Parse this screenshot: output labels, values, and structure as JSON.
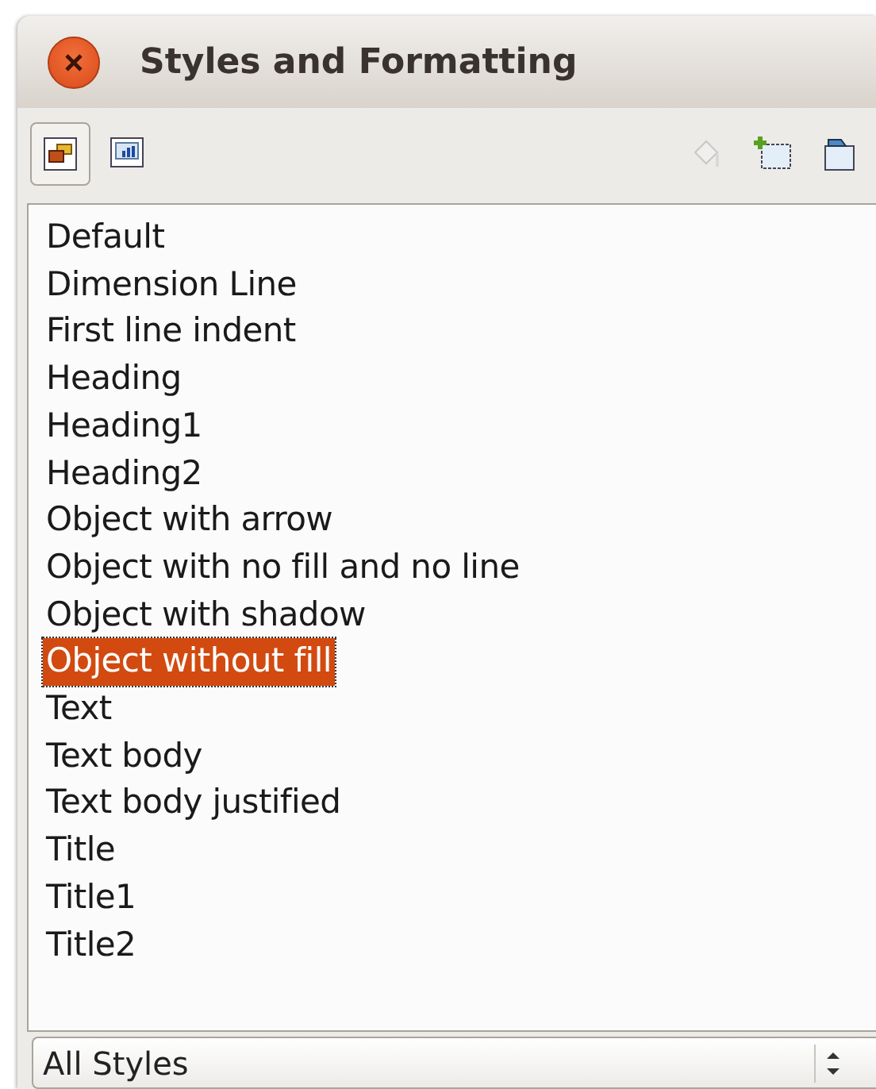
{
  "window": {
    "title": "Styles and Formatting"
  },
  "style_categories": [
    {
      "kind": "graphics",
      "selected": true
    },
    {
      "kind": "presentation",
      "selected": false
    }
  ],
  "actions": [
    {
      "kind": "fill",
      "disabled": true
    },
    {
      "kind": "new",
      "disabled": false
    },
    {
      "kind": "update",
      "disabled": false
    }
  ],
  "styles": [
    {
      "label": "Default",
      "selected": false
    },
    {
      "label": "Dimension Line",
      "selected": false
    },
    {
      "label": "First line indent",
      "selected": false
    },
    {
      "label": "Heading",
      "selected": false
    },
    {
      "label": "Heading1",
      "selected": false
    },
    {
      "label": "Heading2",
      "selected": false
    },
    {
      "label": "Object with arrow",
      "selected": false
    },
    {
      "label": "Object with no fill and no line",
      "selected": false
    },
    {
      "label": "Object with shadow",
      "selected": false
    },
    {
      "label": "Object without fill",
      "selected": true
    },
    {
      "label": "Text",
      "selected": false
    },
    {
      "label": "Text body",
      "selected": false
    },
    {
      "label": "Text body justified",
      "selected": false
    },
    {
      "label": "Title",
      "selected": false
    },
    {
      "label": "Title1",
      "selected": false
    },
    {
      "label": "Title2",
      "selected": false
    }
  ],
  "filter": {
    "value": "All Styles"
  }
}
